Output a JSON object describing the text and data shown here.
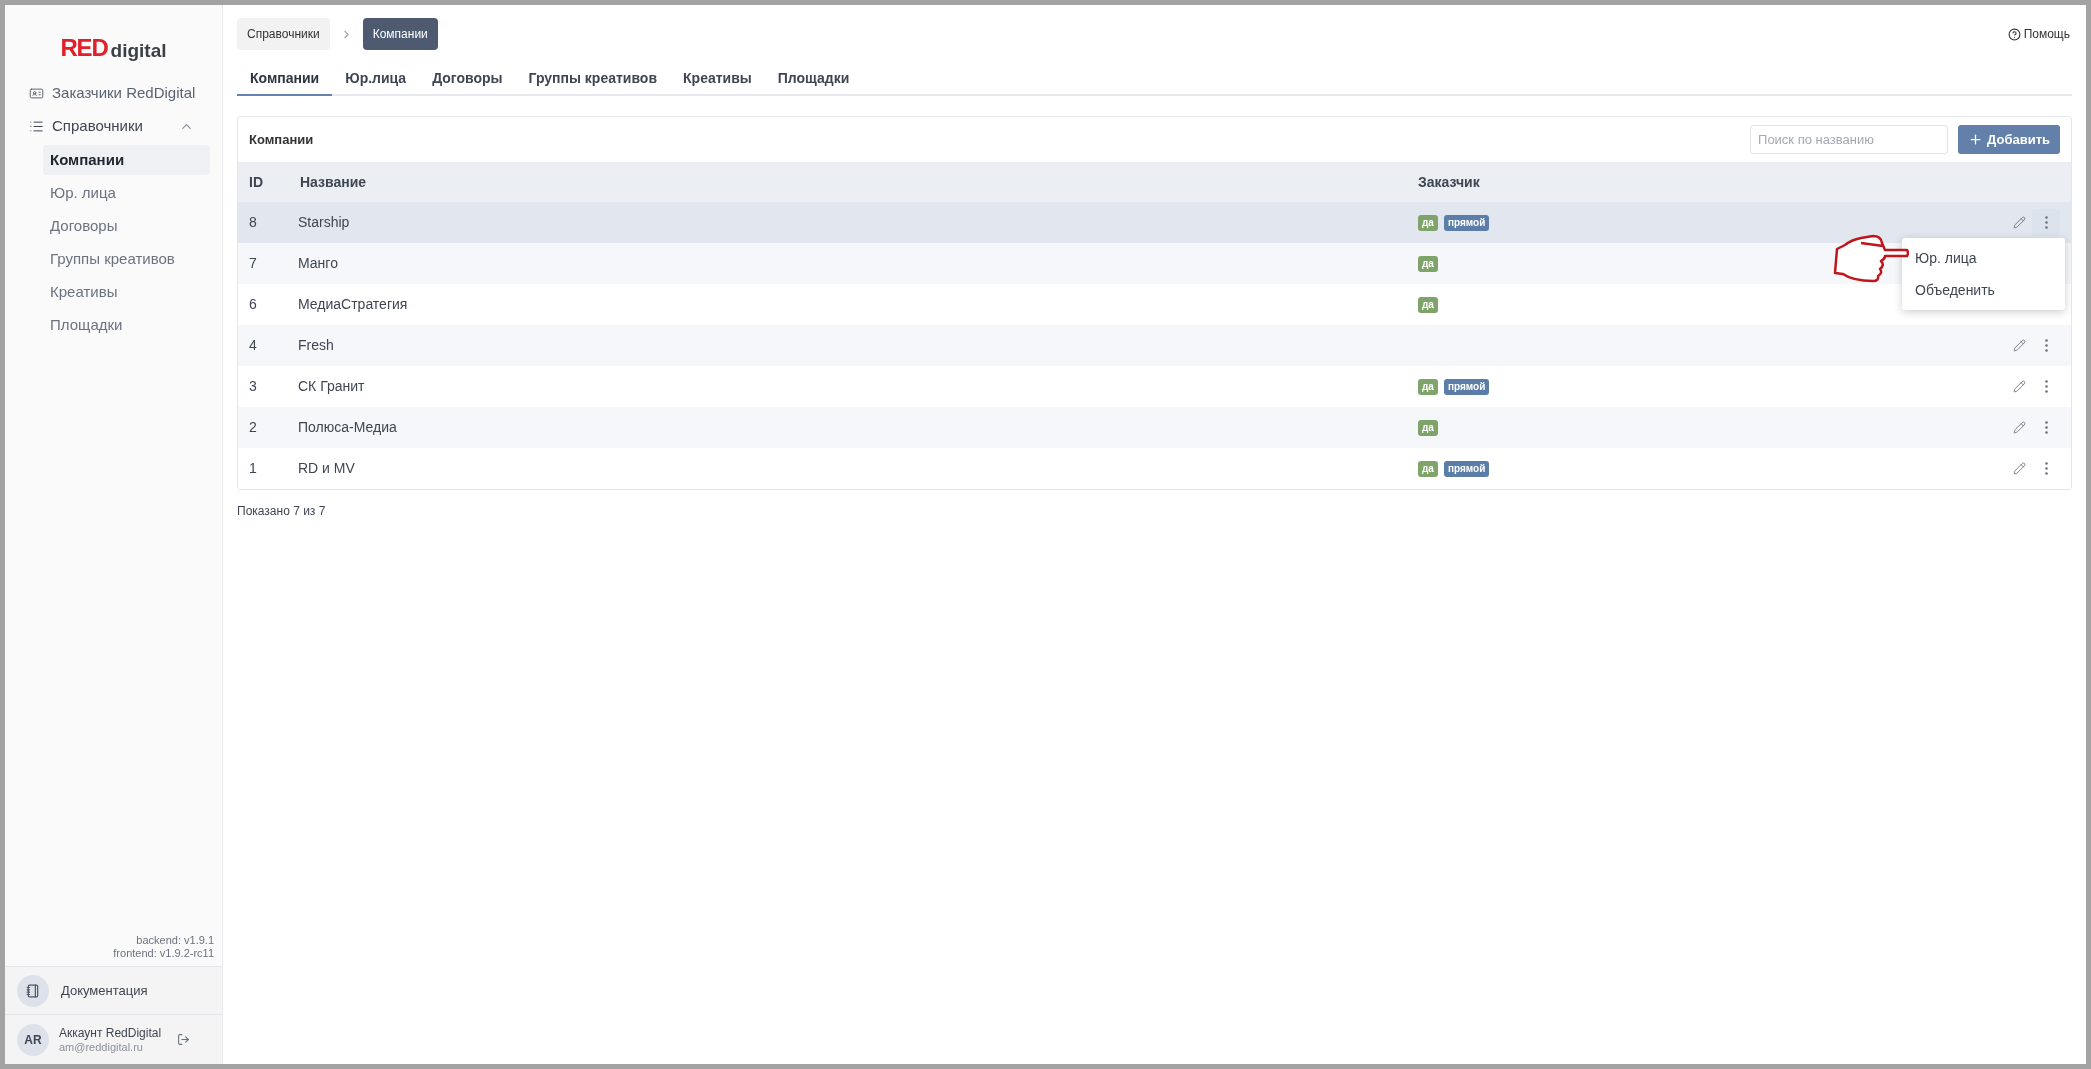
{
  "logo": {
    "brand": "RED",
    "suffix": "digital"
  },
  "sidebar": {
    "items": [
      {
        "label": "Заказчики RedDigital",
        "kind": "link"
      },
      {
        "label": "Справочники",
        "kind": "group",
        "expanded": true,
        "children": [
          {
            "label": "Компании",
            "selected": true
          },
          {
            "label": "Юр. лица",
            "selected": false
          },
          {
            "label": "Договоры",
            "selected": false
          },
          {
            "label": "Группы креативов",
            "selected": false
          },
          {
            "label": "Креативы",
            "selected": false
          },
          {
            "label": "Площадки",
            "selected": false
          }
        ]
      }
    ],
    "versions": [
      "backend: v1.9.1",
      "frontend: v1.9.2-rc11"
    ],
    "docs": {
      "label": "Документация"
    },
    "account": {
      "initials": "AR",
      "name": "Аккаунт RedDigital",
      "email": "am@reddigital.ru"
    }
  },
  "breadcrumb": [
    {
      "label": "Справочники",
      "selected": false
    },
    {
      "label": "Компании",
      "selected": true
    }
  ],
  "help": "Помощь",
  "tabs": [
    {
      "label": "Компании",
      "selected": true
    },
    {
      "label": "Юр.лица",
      "selected": false
    },
    {
      "label": "Договоры",
      "selected": false
    },
    {
      "label": "Группы креативов",
      "selected": false
    },
    {
      "label": "Креативы",
      "selected": false
    },
    {
      "label": "Площадки",
      "selected": false
    }
  ],
  "card": {
    "title": "Компании",
    "search": {
      "placeholder": "Поиск по названию"
    },
    "add_button": "Добавить",
    "table": {
      "columns": [
        "ID",
        "Название",
        "Заказчик"
      ],
      "rows": [
        {
          "id": "8",
          "name": "Starship",
          "tags": [
            {
              "label": "да",
              "kind": "customer"
            },
            {
              "label": "прямой",
              "kind": "direct"
            }
          ],
          "highlighted": true,
          "menu_open": true
        },
        {
          "id": "7",
          "name": "Манго",
          "tags": [
            {
              "label": "да",
              "kind": "customer"
            }
          ],
          "highlighted": false,
          "menu_open": false
        },
        {
          "id": "6",
          "name": "МедиаСтратегия",
          "tags": [
            {
              "label": "да",
              "kind": "customer"
            }
          ],
          "highlighted": false,
          "menu_open": false
        },
        {
          "id": "4",
          "name": "Fresh",
          "tags": [],
          "highlighted": false,
          "menu_open": false
        },
        {
          "id": "3",
          "name": "СК Гранит",
          "tags": [
            {
              "label": "да",
              "kind": "customer"
            },
            {
              "label": "прямой",
              "kind": "direct"
            }
          ],
          "highlighted": false,
          "menu_open": false
        },
        {
          "id": "2",
          "name": "Полюса-Медиа",
          "tags": [
            {
              "label": "да",
              "kind": "customer"
            }
          ],
          "highlighted": false,
          "menu_open": false
        },
        {
          "id": "1",
          "name": "RD и MV",
          "tags": [
            {
              "label": "да",
              "kind": "customer"
            },
            {
              "label": "прямой",
              "kind": "direct"
            }
          ],
          "highlighted": false,
          "menu_open": false
        }
      ]
    }
  },
  "row_menu": {
    "items": [
      "Юр. лица",
      "Объеденить"
    ]
  },
  "footer": "Показано 7 из 7"
}
